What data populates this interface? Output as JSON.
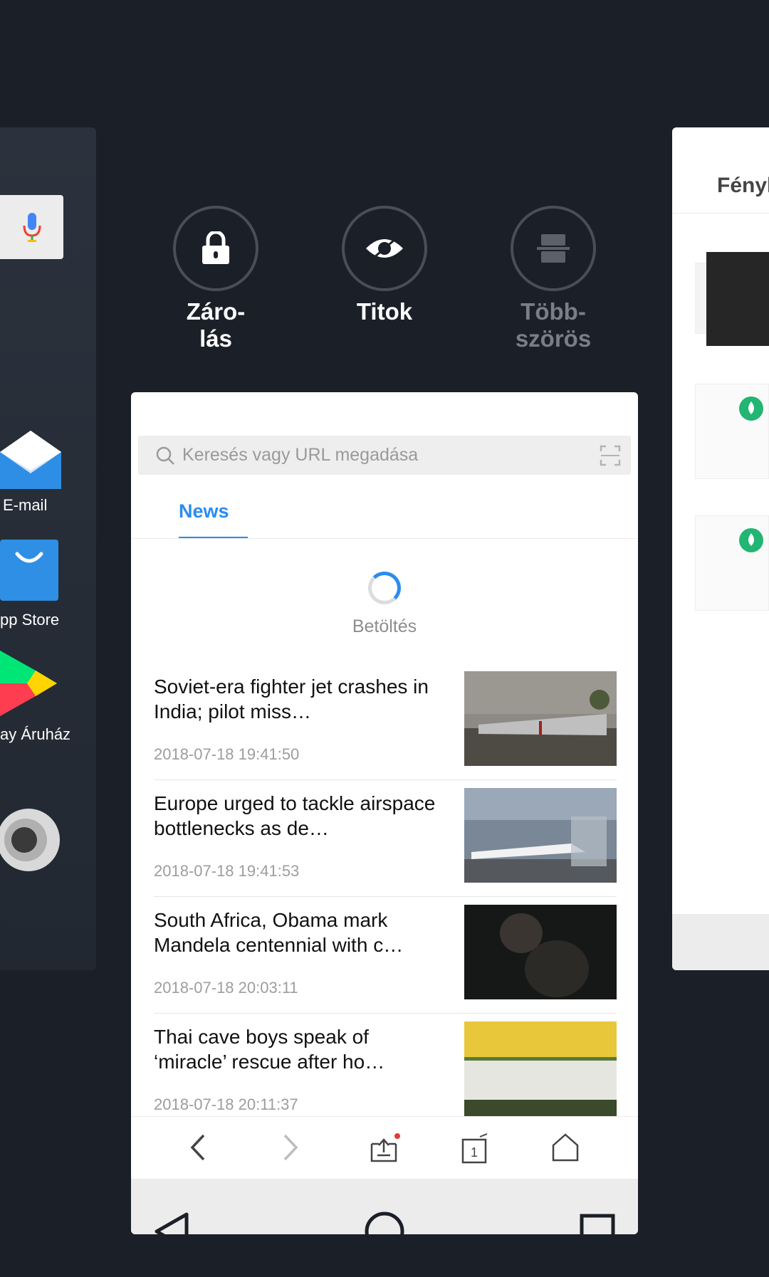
{
  "left_card": {
    "apps": [
      {
        "label": "E-mail"
      },
      {
        "label": "pp Store"
      },
      {
        "label": "ay Áruház"
      }
    ]
  },
  "quick_actions": [
    {
      "label": "Záro-\nlás",
      "icon": "lock-icon",
      "enabled": true
    },
    {
      "label": "Titok",
      "icon": "eye-icon",
      "enabled": true
    },
    {
      "label": "Több-\nszörös",
      "icon": "multi-window-icon",
      "enabled": false
    }
  ],
  "browser": {
    "search_placeholder": "Keresés vagy URL megadása",
    "tabs": [
      {
        "label": "News",
        "active": true
      }
    ],
    "loading_text": "Betöltés",
    "news": [
      {
        "title": "Soviet-era fighter jet crashes in India; pilot miss…",
        "time": "2018-07-18 19:41:50"
      },
      {
        "title": "Europe urged to tackle airspace bottlenecks as de…",
        "time": "2018-07-18 19:41:53"
      },
      {
        "title": "South Africa, Obama mark Mandela centennial with c…",
        "time": "2018-07-18 20:03:11"
      },
      {
        "title": "Thai cave boys speak of ‘miracle’ rescue after ho…",
        "time": "2018-07-18 20:11:37"
      }
    ],
    "tab_count": "1"
  },
  "right_card": {
    "title": "Fényk"
  },
  "colors": {
    "accent": "#2a8cf0",
    "background": "#1b1f27"
  }
}
